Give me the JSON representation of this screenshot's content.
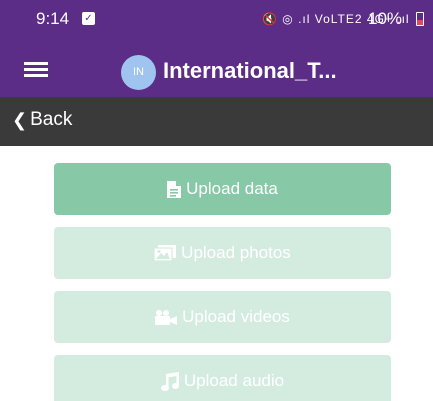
{
  "status_bar": {
    "time": "9:14",
    "icons": "🔇 ◎ .ıl VoLTE2 4G+ .ıl",
    "battery": "10%"
  },
  "app_bar": {
    "avatar_initials": "IN",
    "title": "International_T..."
  },
  "back_bar": {
    "label": "Back"
  },
  "buttons": {
    "upload_data": "Upload data",
    "upload_photos": "Upload photos",
    "upload_videos": "Upload videos",
    "upload_audio": "Upload audio"
  },
  "colors": {
    "brand_purple": "#5b2d86",
    "back_bar": "#3a3a3a",
    "active_green": "#87c9a6",
    "faded_green": "#d4ecdf"
  }
}
